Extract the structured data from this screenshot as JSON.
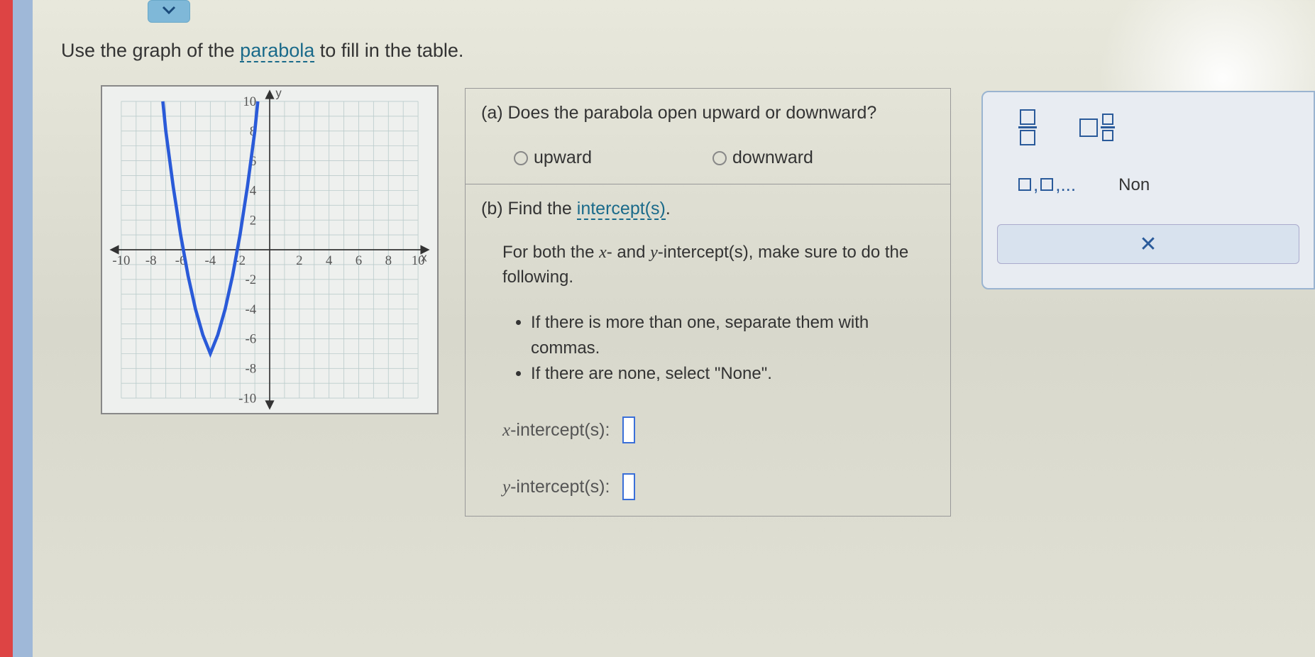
{
  "instruction": {
    "prefix": "Use the graph of the ",
    "term": "parabola",
    "suffix": " to fill in the table."
  },
  "question_a": {
    "prompt": "(a) Does the parabola open upward or downward?",
    "option1": "upward",
    "option2": "downward"
  },
  "question_b": {
    "prefix": "(b) Find the ",
    "term": "intercept(s)",
    "suffix": ".",
    "subtext_line1": "For both the x- and y-intercept(s), make sure",
    "subtext_line2": "to do the following.",
    "bullet1": "If there is more than one, separate them with commas.",
    "bullet2": "If there are none, select \"None\"."
  },
  "intercepts": {
    "x_label_var": "x",
    "x_label_rest": "-intercept(s):",
    "y_label_var": "y",
    "y_label_rest": "-intercept(s):"
  },
  "toolpanel": {
    "list_symbol": "□,□,...",
    "none_label": "Non",
    "close": "✕"
  },
  "chart_data": {
    "type": "line",
    "title": "",
    "xlabel": "x",
    "ylabel": "y",
    "xlim": [
      -10,
      10
    ],
    "ylim": [
      -10,
      10
    ],
    "x_ticks": [
      -10,
      -8,
      -6,
      -4,
      -2,
      2,
      4,
      6,
      8,
      10
    ],
    "y_ticks": [
      -10,
      -8,
      -6,
      -4,
      -2,
      2,
      4,
      6,
      8,
      10
    ],
    "series": [
      {
        "name": "parabola",
        "x": [
          -7.2,
          -7,
          -6.5,
          -6,
          -5.5,
          -5,
          -4.5,
          -4,
          -3.5,
          -3,
          -2.5,
          -2,
          -1.5,
          -1,
          -0.8
        ],
        "y": [
          10,
          8,
          4.25,
          1,
          -1.75,
          -4,
          -5.75,
          -7,
          -5.75,
          -4,
          -1.75,
          1,
          4.25,
          8,
          10
        ]
      }
    ],
    "vertex": {
      "x": -4,
      "y": -7
    },
    "x_intercepts": [
      -6,
      -2
    ],
    "opens": "upward"
  }
}
